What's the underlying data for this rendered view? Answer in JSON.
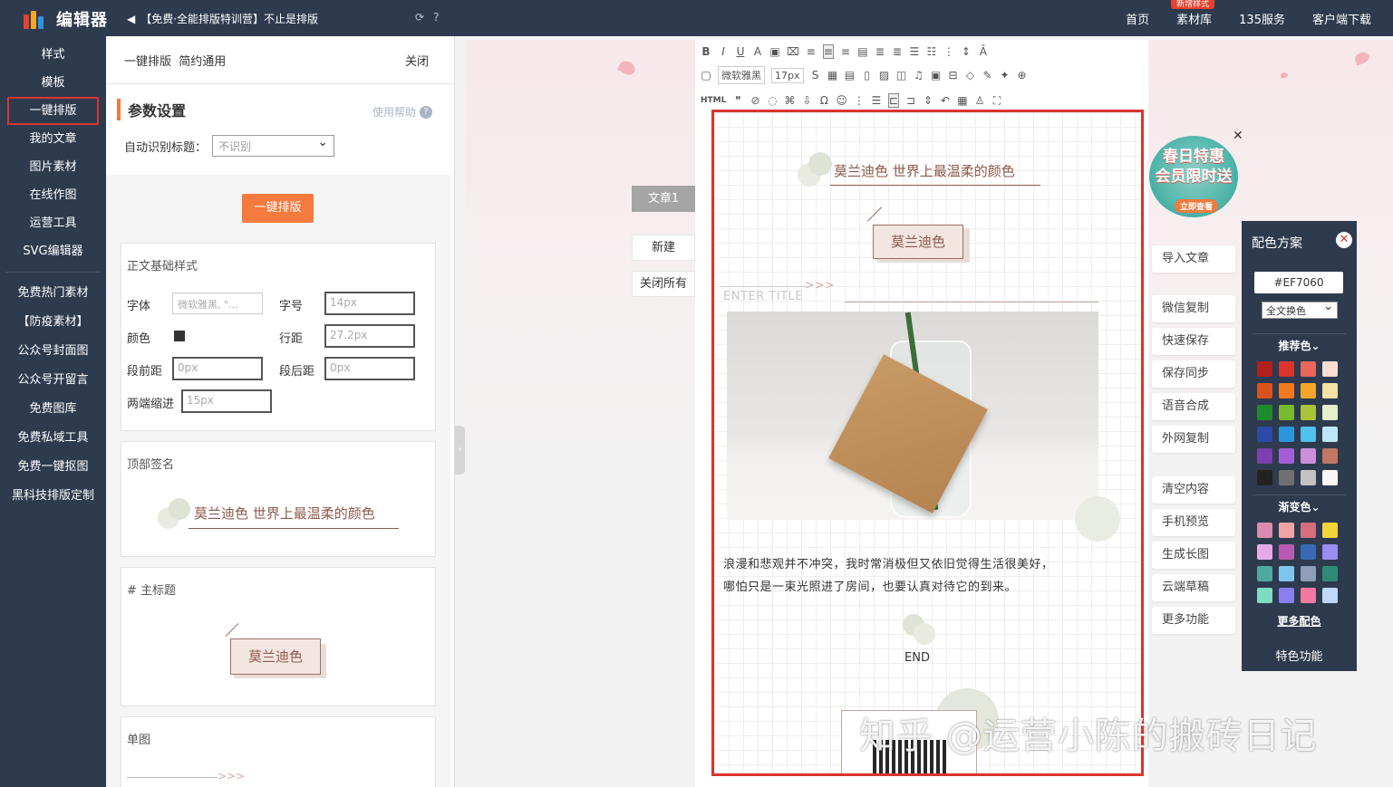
{
  "topbar": {
    "logo_text": "编辑器",
    "notice": "【免费·全能排版特训营】不止是排版",
    "nav": [
      "首页",
      "素材库",
      "135服务",
      "客户端下载"
    ],
    "badge": "新增样式"
  },
  "sidebar": {
    "items": [
      "样式",
      "模板",
      "一键排版",
      "我的文章",
      "图片素材",
      "在线作图",
      "运营工具",
      "SVG编辑器"
    ],
    "active": "一键排版",
    "extra": [
      "免费热门素材",
      "【防疫素材】",
      "公众号封面图",
      "公众号开留言",
      "免费图库",
      "免费私域工具",
      "免费一键抠图",
      "黑科技排版定制"
    ]
  },
  "panel": {
    "title": "一键排版  简约通用",
    "close": "关闭",
    "param_title": "参数设置",
    "help": "使用帮助",
    "auto_title_label": "自动识别标题：",
    "auto_title_value": "不识别",
    "format_button": "一键排版",
    "base_card": {
      "title": "正文基础样式",
      "font_label": "字体",
      "font_value": "微软雅黑, \"...",
      "size_label": "字号",
      "size_value": "14px",
      "color_label": "颜色",
      "line_label": "行距",
      "line_value": "27.2px",
      "before_label": "段前距",
      "before_value": "0px",
      "after_label": "段后距",
      "after_value": "0px",
      "indent_label": "两端缩进",
      "indent_value": "15px"
    },
    "sig_card": {
      "title": "顶部签名",
      "text": "莫兰迪色  世界上最温柔的颜色"
    },
    "title_card": {
      "title": "# 主标题",
      "text": "莫兰迪色"
    },
    "image_card": {
      "title": "单图"
    }
  },
  "docs": {
    "tab": "文章1",
    "new": "新建",
    "close_all": "关闭所有"
  },
  "editor": {
    "font_select": "微软雅黑",
    "size_select": "17px",
    "html_label": "HTML",
    "signature": "莫兰迪色  世界上最温柔的颜色",
    "title": "莫兰迪色",
    "enter_title": "ENTER TITLE",
    "para1": "浪漫和悲观并不冲突，我时常消极但又依旧觉得生活很美好，",
    "para2": "哪怕只是一束光照进了房间，也要认真对待它的到来。",
    "end": "END",
    "watermark": "知乎 @运营小陈的搬砖日记"
  },
  "actions": [
    "导入文章",
    "微信复制",
    "快速保存",
    "保存同步",
    "语音合成",
    "外网复制",
    "清空内容",
    "手机预览",
    "生成长图",
    "云端草稿",
    "更多功能"
  ],
  "promo": {
    "line1": "春日特惠",
    "line2": "会员限时送",
    "line3": "立即查看"
  },
  "scheme": {
    "title": "配色方案",
    "hex": "#EF7060",
    "mode": "全文换色",
    "recommend": "推荐色⌄",
    "gradient": "渐变色⌄",
    "more": "更多配色",
    "special": "特色功能",
    "solid_colors": [
      "#b0211d",
      "#d9352d",
      "#e8675a",
      "#f9ddd4",
      "#d9541c",
      "#f07a1f",
      "#f5a52a",
      "#f7e2a5",
      "#1f8a2e",
      "#7aba2e",
      "#a8c43a",
      "#e3f0c9",
      "#2c4aa8",
      "#2a97dd",
      "#4fc1ec",
      "#bfe6f7",
      "#7b3fb0",
      "#a55fd6",
      "#c98fd9",
      "#c07764",
      "#222222",
      "#707070",
      "#c2c2c2",
      "#f7f7f7"
    ],
    "gradient_colors": [
      "#d98caf",
      "#f0a4a4",
      "#d56f7e",
      "#f5d43a",
      "#e6a8e6",
      "#b85bb2",
      "#3a6bb2",
      "#9a8ef0",
      "#4fa8a2",
      "#7fc6ec",
      "#8f9fb8",
      "#2f8a7a",
      "#7fdcc0",
      "#8a7ef0",
      "#f07aa0",
      "#bfd9f7"
    ]
  }
}
